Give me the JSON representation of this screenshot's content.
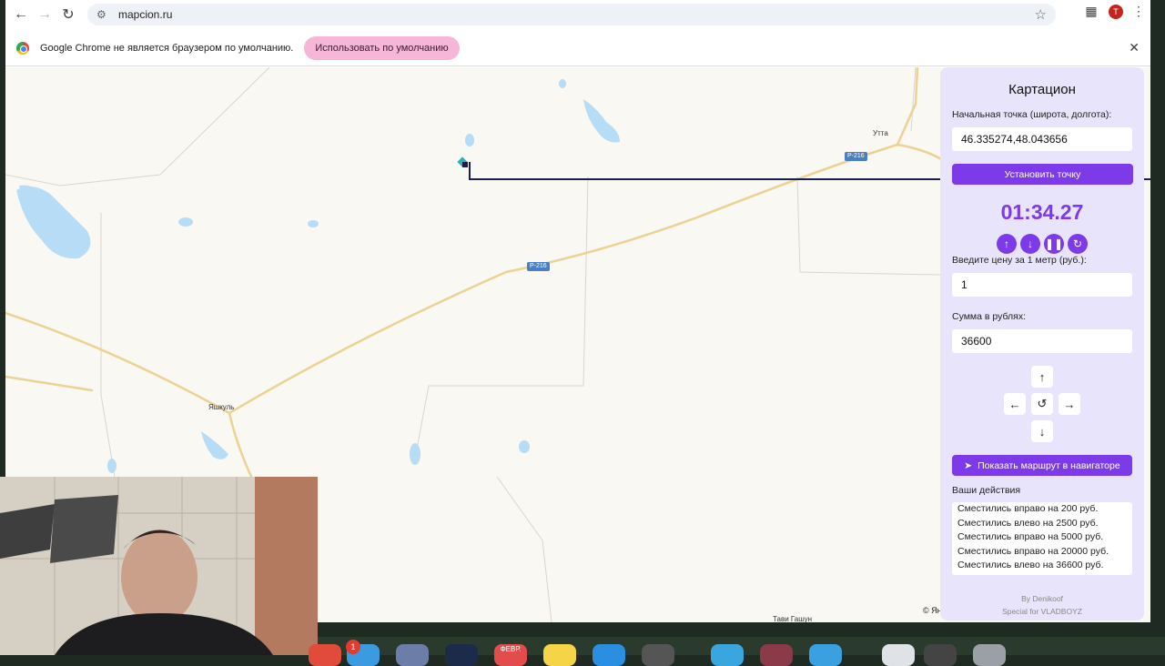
{
  "browser": {
    "url": "mapcion.ru",
    "profile_initial": "T",
    "nav_icons": [
      "back-icon",
      "forward-icon",
      "reload-icon"
    ],
    "infobar": {
      "message": "Google Chrome не является браузером по умолчанию.",
      "button_label": "Использовать по умолчанию"
    }
  },
  "map": {
    "places": [
      "Утта",
      "Яшкуль",
      "Тави Гашун"
    ],
    "road_labels": [
      "Р-216",
      "Р-216"
    ],
    "copyright": "© Ян"
  },
  "panel": {
    "title": "Картацион",
    "start_label": "Начальная точка (широта, долгота):",
    "start_value": "46.335274,48.043656",
    "set_point_label": "Установить точку",
    "timer": "01:34.27",
    "timer_controls": [
      "arrow-up-icon",
      "arrow-down-icon",
      "pause-icon",
      "refresh-icon"
    ],
    "price_label": "Введите цену за 1 метр (руб.):",
    "price_value": "1",
    "sum_label": "Сумма в рублях:",
    "sum_value": "36600",
    "navigator_label": "Показать маршрут в навигаторе",
    "actions_label": "Ваши действия",
    "actions": [
      "Сместились вправо на 200 руб.",
      "Сместились влево на 2500 руб.",
      "Сместились вправо на 5000 руб.",
      "Сместились вправо на 20000 руб.",
      "Сместились влево на 36600 руб."
    ],
    "footer_by": "By Denikoof",
    "footer_special": "Special for VLADBOYZ"
  },
  "dock": {
    "badge_count": "1",
    "calendar_label": "ФЕВР."
  },
  "colors": {
    "accent": "#7c3ae8",
    "panel_bg": "#e8e4fb",
    "route": "#1a1f4d",
    "road": "#ecd293",
    "water": "#b7dcf5"
  }
}
